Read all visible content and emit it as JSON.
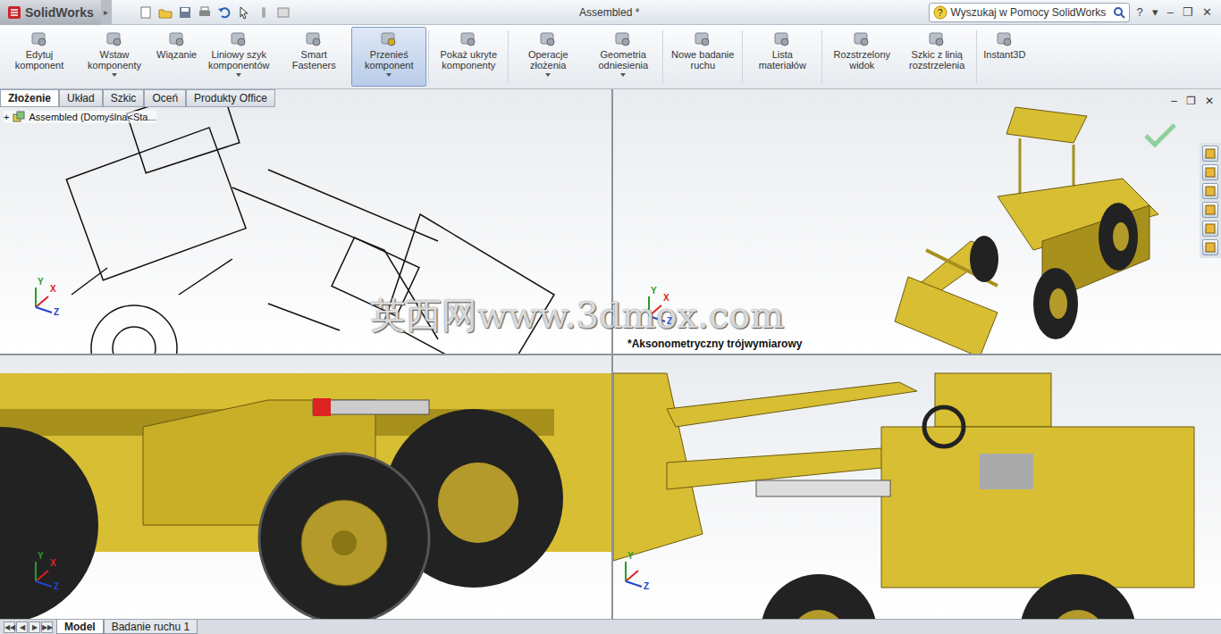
{
  "app": {
    "logo": "SolidWorks",
    "expand": "▸"
  },
  "window": {
    "title": "Assembled *"
  },
  "search": {
    "placeholder": "Wyszukaj w Pomocy SolidWorks"
  },
  "title_controls": [
    "?",
    "▾",
    "–",
    "❐",
    "✕"
  ],
  "ribbon": [
    {
      "label": "Edytuj komponent",
      "selected": false,
      "dropdown": false,
      "group": 1
    },
    {
      "label": "Wstaw komponenty",
      "selected": false,
      "dropdown": true,
      "group": 1
    },
    {
      "label": "Wiązanie",
      "selected": false,
      "dropdown": false,
      "group": 1
    },
    {
      "label": "Liniowy szyk komponentów",
      "selected": false,
      "dropdown": true,
      "group": 1
    },
    {
      "label": "Smart Fasteners",
      "selected": false,
      "dropdown": false,
      "group": 1
    },
    {
      "label": "Przenieś komponent",
      "selected": true,
      "dropdown": true,
      "group": 1
    },
    {
      "label": "Pokaż ukryte komponenty",
      "selected": false,
      "dropdown": false,
      "group": 2
    },
    {
      "label": "Operacje złożenia",
      "selected": false,
      "dropdown": true,
      "group": 3
    },
    {
      "label": "Geometria odniesienia",
      "selected": false,
      "dropdown": true,
      "group": 3
    },
    {
      "label": "Nowe badanie ruchu",
      "selected": false,
      "dropdown": false,
      "group": 4
    },
    {
      "label": "Lista materiałów",
      "selected": false,
      "dropdown": false,
      "group": 5
    },
    {
      "label": "Rozstrzelony widok",
      "selected": false,
      "dropdown": false,
      "group": 6
    },
    {
      "label": "Szkic z linią rozstrzelenia",
      "selected": false,
      "dropdown": false,
      "group": 6
    },
    {
      "label": "Instant3D",
      "selected": false,
      "dropdown": false,
      "group": 7
    }
  ],
  "tabs": [
    {
      "label": "Złożenie",
      "selected": true
    },
    {
      "label": "Układ",
      "selected": false
    },
    {
      "label": "Szkic",
      "selected": false
    },
    {
      "label": "Oceń",
      "selected": false
    },
    {
      "label": "Produkty Office",
      "selected": false
    }
  ],
  "tree": {
    "expander": "+",
    "root": "Assembled  (Domyślna<Sta..."
  },
  "viewports": [
    {
      "kind": "wireframe",
      "label": "",
      "axes": [
        "X",
        "Y",
        "Z"
      ]
    },
    {
      "kind": "iso",
      "label": "*Aksonometryczny trójwymiarowy",
      "axes": [
        "X",
        "Y",
        "Z"
      ],
      "controls": [
        "–",
        "❐",
        "✕"
      ]
    },
    {
      "kind": "closeup",
      "label": "",
      "axes": [
        "X",
        "Y",
        "Z"
      ]
    },
    {
      "kind": "side",
      "label": "",
      "axes": [
        "Y",
        "Z"
      ]
    }
  ],
  "watermark": "英西网www.3dmox.com",
  "bottom_nav": [
    "◀◀",
    "◀",
    "▶",
    "▶▶"
  ],
  "bottom_tabs": [
    {
      "label": "Model",
      "selected": true
    },
    {
      "label": "Badanie ruchu 1",
      "selected": false
    }
  ]
}
